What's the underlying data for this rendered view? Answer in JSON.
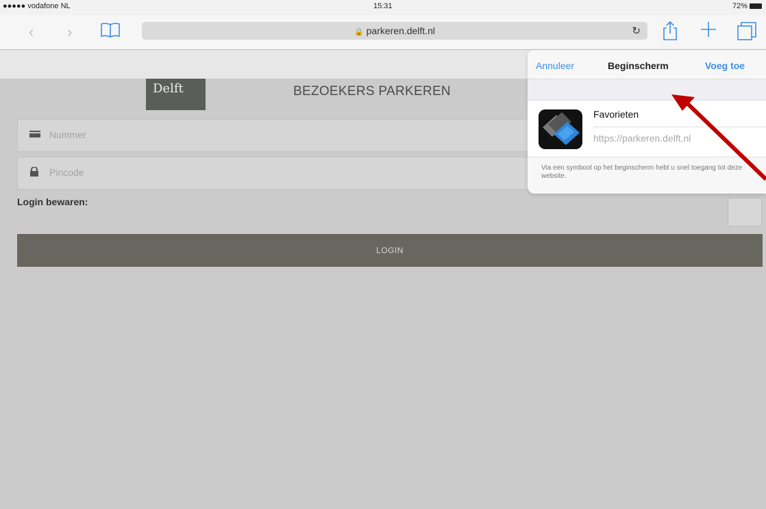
{
  "statusbar": {
    "carrier": "●●●●● vodafone NL",
    "time": "15:31",
    "battery": "72%"
  },
  "browser": {
    "url": "parkeren.delft.nl",
    "back_icon": "chevron-left",
    "forward_icon": "chevron-right",
    "bookmarks_icon": "book",
    "reload_icon": "reload",
    "share_icon": "share",
    "newtab_icon": "plus",
    "tabs_icon": "tabs"
  },
  "page": {
    "logo_text": "Delft",
    "title": "BEZOEKERS PARKEREN",
    "number_placeholder": "Nummer",
    "pincode_placeholder": "Pincode",
    "remember_label": "Login bewaren:",
    "login_button": "LOGIN"
  },
  "popover": {
    "cancel": "Annuleer",
    "title": "Beginscherm",
    "add": "Voeg toe",
    "app_name": "Favorieten",
    "app_url": "https://parkeren.delft.nl",
    "note": "Via een symbool op het beginscherm hebt u snel toegang tot deze website."
  },
  "colors": {
    "accent": "#3a8fe8",
    "arrow": "#c00000",
    "login_button": "#67675f"
  }
}
